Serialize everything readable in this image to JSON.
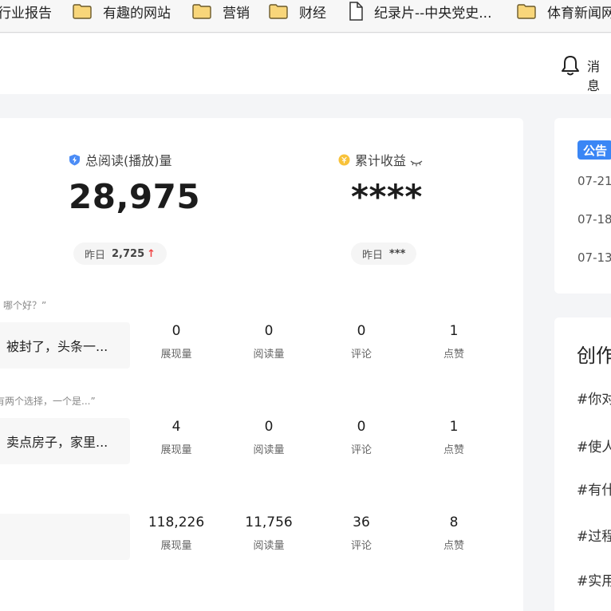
{
  "bookmarks": [
    {
      "label": "行业报告",
      "icon": "none"
    },
    {
      "label": "有趣的网站",
      "icon": "folder-icon"
    },
    {
      "label": "营销",
      "icon": "folder-icon"
    },
    {
      "label": "财经",
      "icon": "folder-icon"
    },
    {
      "label": "纪录片--中央党史...",
      "icon": "document-icon"
    },
    {
      "label": "体育新闻网",
      "icon": "folder-icon"
    }
  ],
  "header": {
    "messages_label": "消息"
  },
  "stats": {
    "reads": {
      "title": "总阅读(播放)量",
      "value": "28,975",
      "yesterday_label": "昨日",
      "yesterday_value": "2,725",
      "trend": "↑"
    },
    "income": {
      "title": "累计收益",
      "value": "****",
      "yesterday_label": "昨日",
      "yesterday_value": "***"
    }
  },
  "articles": [
    {
      "hint": "哪个好？”",
      "title": "被封了，头条一...",
      "metrics": [
        "0",
        "0",
        "0",
        "1"
      ]
    },
    {
      "hint": "有两个选择，一个是...”",
      "title": "卖点房子，家里...",
      "metrics": [
        "4",
        "0",
        "0",
        "1"
      ]
    },
    {
      "hint": "",
      "title": "",
      "metrics": [
        "118,226",
        "11,756",
        "36",
        "8"
      ]
    }
  ],
  "metric_labels": [
    "展现量",
    "阅读量",
    "评论",
    "点赞"
  ],
  "notice": {
    "badge": "公告",
    "dates": [
      "07-21",
      "07-18",
      "07-13"
    ]
  },
  "create": {
    "title": "创作",
    "topics": [
      "#你对",
      "#使人",
      "#有什",
      "#过程",
      "#实用"
    ]
  },
  "colors": {
    "accent": "#3a86f5",
    "coin": "#f8c23a",
    "trend_up": "#f04545"
  }
}
